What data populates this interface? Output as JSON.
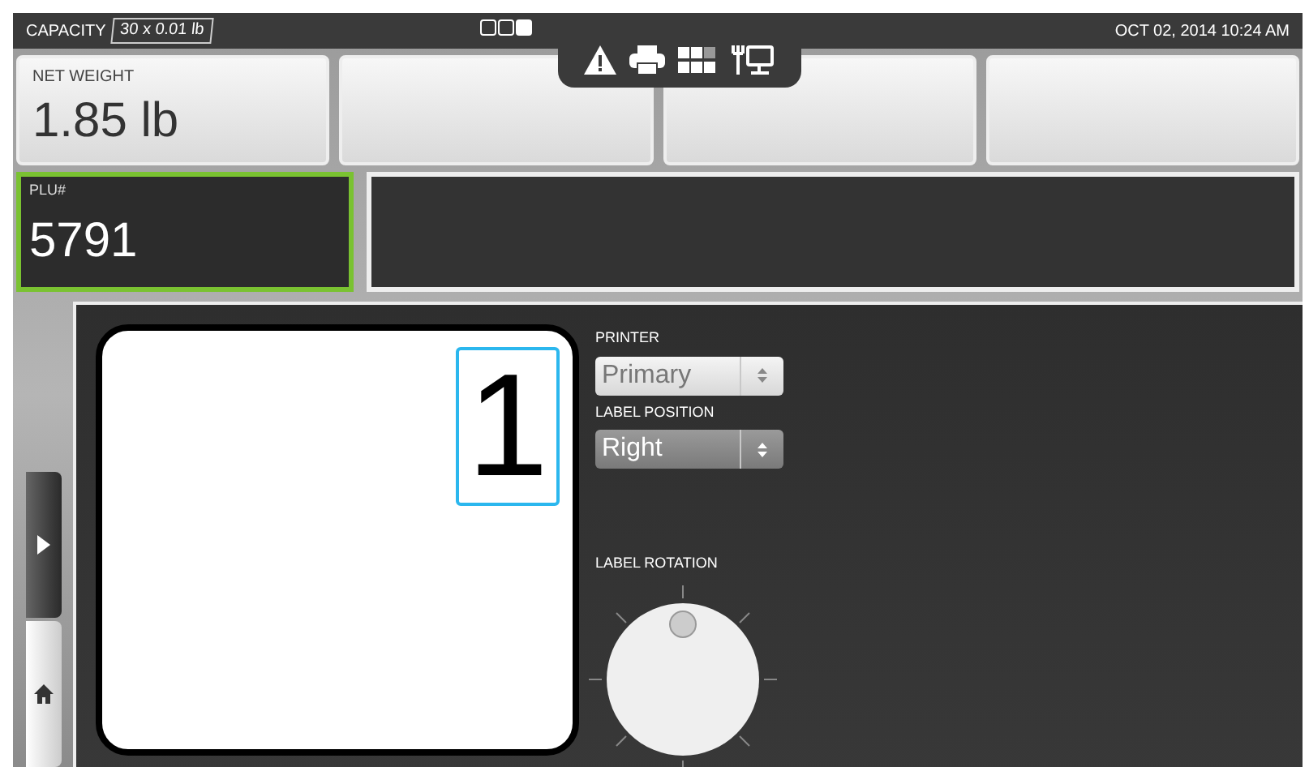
{
  "top_bar": {
    "capacity_label": "CAPACITY",
    "capacity_value": "30 x 0.01 lb",
    "pages": [
      {
        "selected": false
      },
      {
        "selected": false
      },
      {
        "selected": true
      }
    ],
    "datetime": "OCT 02, 2014 10:24 AM"
  },
  "tiles": [
    {
      "label": "NET WEIGHT",
      "value": "1.85 lb"
    }
  ],
  "plu": {
    "label": "PLU#",
    "value": "5791",
    "selected": true
  },
  "label_preview": {
    "number": "1"
  },
  "printer": {
    "label": "PRINTER",
    "value": "Primary",
    "disabled": false
  },
  "label_position": {
    "label": "LABEL POSITION",
    "value": "Right",
    "disabled": true
  },
  "label_rotation": {
    "label": "LABEL ROTATION"
  }
}
